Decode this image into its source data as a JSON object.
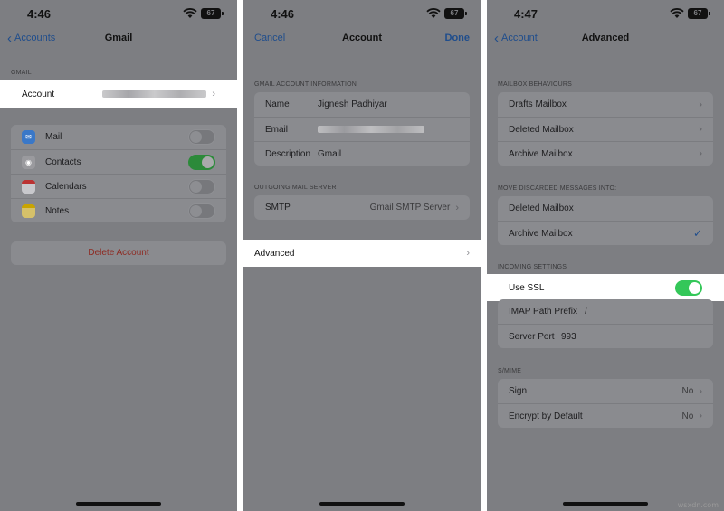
{
  "panel1": {
    "status": {
      "time": "4:46",
      "battery": "67"
    },
    "nav": {
      "back": "Accounts",
      "title": "Gmail"
    },
    "section_header": "GMAIL",
    "account_row": {
      "label": "Account"
    },
    "apps": [
      {
        "label": "Mail",
        "icon": "mail-icon",
        "color": "#3a78c8",
        "on": false
      },
      {
        "label": "Contacts",
        "icon": "contacts-icon",
        "color": "#8e8e93",
        "on": true
      },
      {
        "label": "Calendars",
        "icon": "calendar-icon",
        "color": "#f2f2f7",
        "on": false
      },
      {
        "label": "Notes",
        "icon": "notes-icon",
        "color": "#f5c400",
        "on": false
      }
    ],
    "delete_label": "Delete Account"
  },
  "panel2": {
    "status": {
      "time": "4:46",
      "battery": "67"
    },
    "nav": {
      "left": "Cancel",
      "title": "Account",
      "right": "Done"
    },
    "section1_header": "GMAIL ACCOUNT INFORMATION",
    "name_label": "Name",
    "name_value": "Jignesh Padhiyar",
    "email_label": "Email",
    "description_label": "Description",
    "description_value": "Gmail",
    "section2_header": "OUTGOING MAIL SERVER",
    "smtp_label": "SMTP",
    "smtp_value": "Gmail SMTP Server",
    "advanced_label": "Advanced"
  },
  "panel3": {
    "status": {
      "time": "4:47",
      "battery": "67"
    },
    "nav": {
      "back": "Account",
      "title": "Advanced"
    },
    "section1_header": "MAILBOX BEHAVIOURS",
    "mailboxes": [
      "Drafts Mailbox",
      "Deleted Mailbox",
      "Archive Mailbox"
    ],
    "section2_header": "MOVE DISCARDED MESSAGES INTO:",
    "discard_options": [
      "Deleted Mailbox",
      "Archive Mailbox"
    ],
    "section3_header": "INCOMING SETTINGS",
    "ssl_label": "Use SSL",
    "imap_label": "IMAP Path Prefix",
    "imap_value": "/",
    "port_label": "Server Port",
    "port_value": "993",
    "section4_header": "S/MIME",
    "sign_label": "Sign",
    "sign_value": "No",
    "encrypt_label": "Encrypt by Default",
    "encrypt_value": "No"
  },
  "watermark": "wsxdn.com"
}
